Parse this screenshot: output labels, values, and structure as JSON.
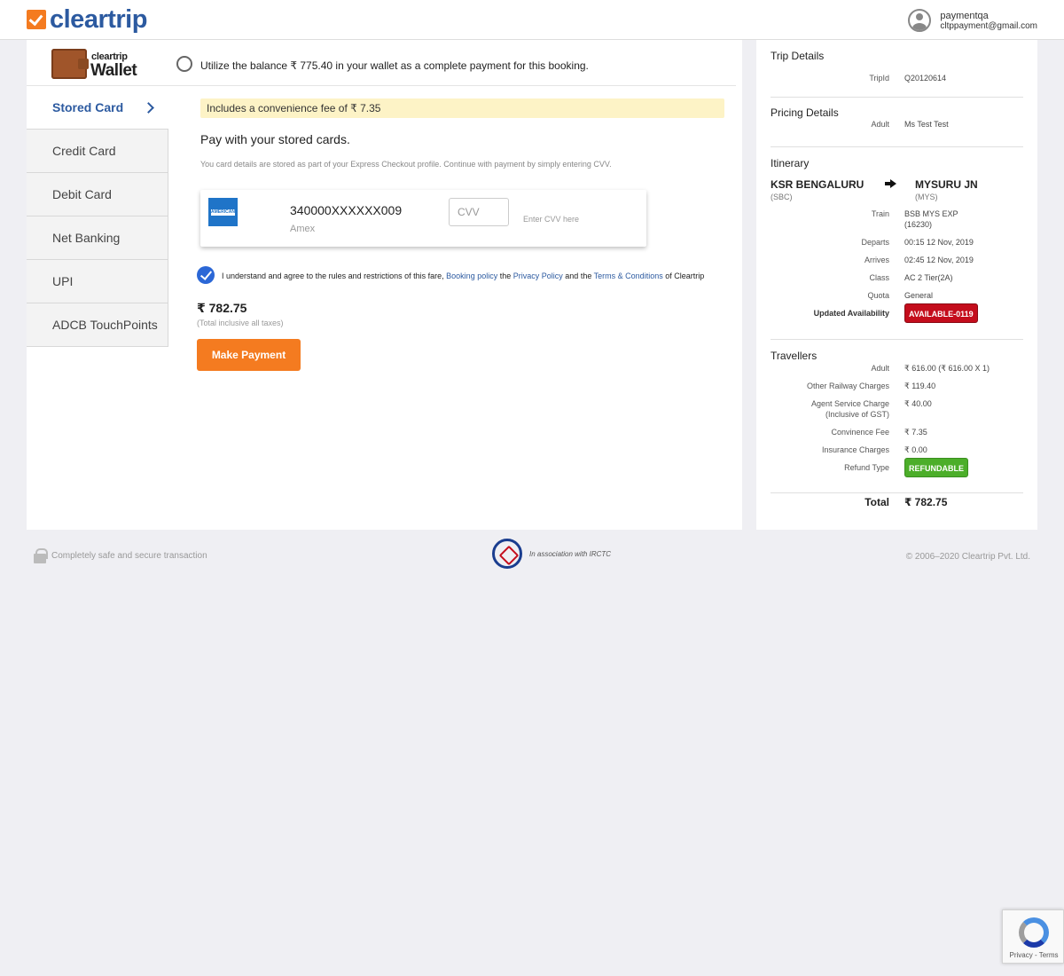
{
  "header": {
    "logo_text": "cleartrip",
    "user_name": "paymentqa",
    "user_email": "cltppayment@gmail.com"
  },
  "wallet": {
    "brand": "cleartrip",
    "title": "Wallet",
    "option_text": "Utilize the balance ₹ 775.40 in your wallet as a complete payment for this booking."
  },
  "tabs": [
    {
      "label": "Stored Card"
    },
    {
      "label": "Credit Card"
    },
    {
      "label": "Debit Card"
    },
    {
      "label": "Net Banking"
    },
    {
      "label": "UPI"
    },
    {
      "label": "ADCB TouchPoints"
    }
  ],
  "content": {
    "fee_note": "Includes a convenience fee of ₹ 7.35",
    "pay_title": "Pay with your stored cards.",
    "pay_sub": "You card details are stored as part of your Express Checkout profile. Continue with payment by simply entering CVV.",
    "card_number": "340000XXXXXX009",
    "card_type": "Amex",
    "amex_logo_text": "AMERICAN EXPRESS",
    "cvv_placeholder": "CVV",
    "cvv_hint": "Enter CVV here",
    "agree_pre": "I understand and agree to the rules and restrictions of this fare,",
    "agree_link1": "Booking policy",
    "agree_mid1": "the",
    "agree_link2": "Privacy Policy",
    "agree_mid2": "and the",
    "agree_link3": "Terms & Conditions",
    "agree_post": "of Cleartrip",
    "total_amount": "₹ 782.75",
    "total_note": "(Total inclusive all taxes)",
    "pay_button": "Make Payment"
  },
  "sidebar": {
    "trip_title": "Trip Details",
    "trip_id_label": "TripId",
    "trip_id": "Q20120614",
    "pricing_title": "Pricing Details",
    "pricing_label": "Adult",
    "pricing_value": "Ms Test Test",
    "itinerary_title": "Itinerary",
    "from_station": "KSR BENGALURU",
    "from_code": "(SBC)",
    "to_station": "MYSURU JN",
    "to_code": "(MYS)",
    "train_label": "Train",
    "train_value": "BSB MYS EXP",
    "train_no": "(16230)",
    "departs_label": "Departs",
    "departs_value": "00:15 12 Nov, 2019",
    "arrives_label": "Arrives",
    "arrives_value": "02:45 12 Nov, 2019",
    "class_label": "Class",
    "class_value": "AC 2 Tier(2A)",
    "quota_label": "Quota",
    "quota_value": "General",
    "avail_label": "Updated Availability",
    "avail_value": "AVAILABLE-0119",
    "travellers_title": "Travellers",
    "adult_label": "Adult",
    "adult_value": "₹ 616.00 (₹ 616.00 X 1)",
    "railway_label": "Other Railway Charges",
    "railway_value": "₹ 119.40",
    "agent_label": "Agent Service Charge",
    "agent_label2": "(Inclusive of GST)",
    "agent_value": "₹ 40.00",
    "conv_label": "Convinence Fee",
    "conv_value": "₹ 7.35",
    "ins_label": "Insurance Charges",
    "ins_value": "₹ 0.00",
    "refund_label": "Refund Type",
    "refund_value": "REFUNDABLE",
    "total_label": "Total",
    "total_value": "₹ 782.75"
  },
  "footer": {
    "secure_text": "Completely safe and secure transaction",
    "irctc_text": "In association with IRCTC",
    "copyright": "© 2006–2020 Cleartrip Pvt. Ltd."
  },
  "recaptcha": {
    "text": "Privacy - Terms"
  },
  "colors": {
    "brand_blue": "#2c5aa0",
    "accent_orange": "#f47b20",
    "available_red": "#c40d1c",
    "refundable_green": "#4cae2a"
  }
}
